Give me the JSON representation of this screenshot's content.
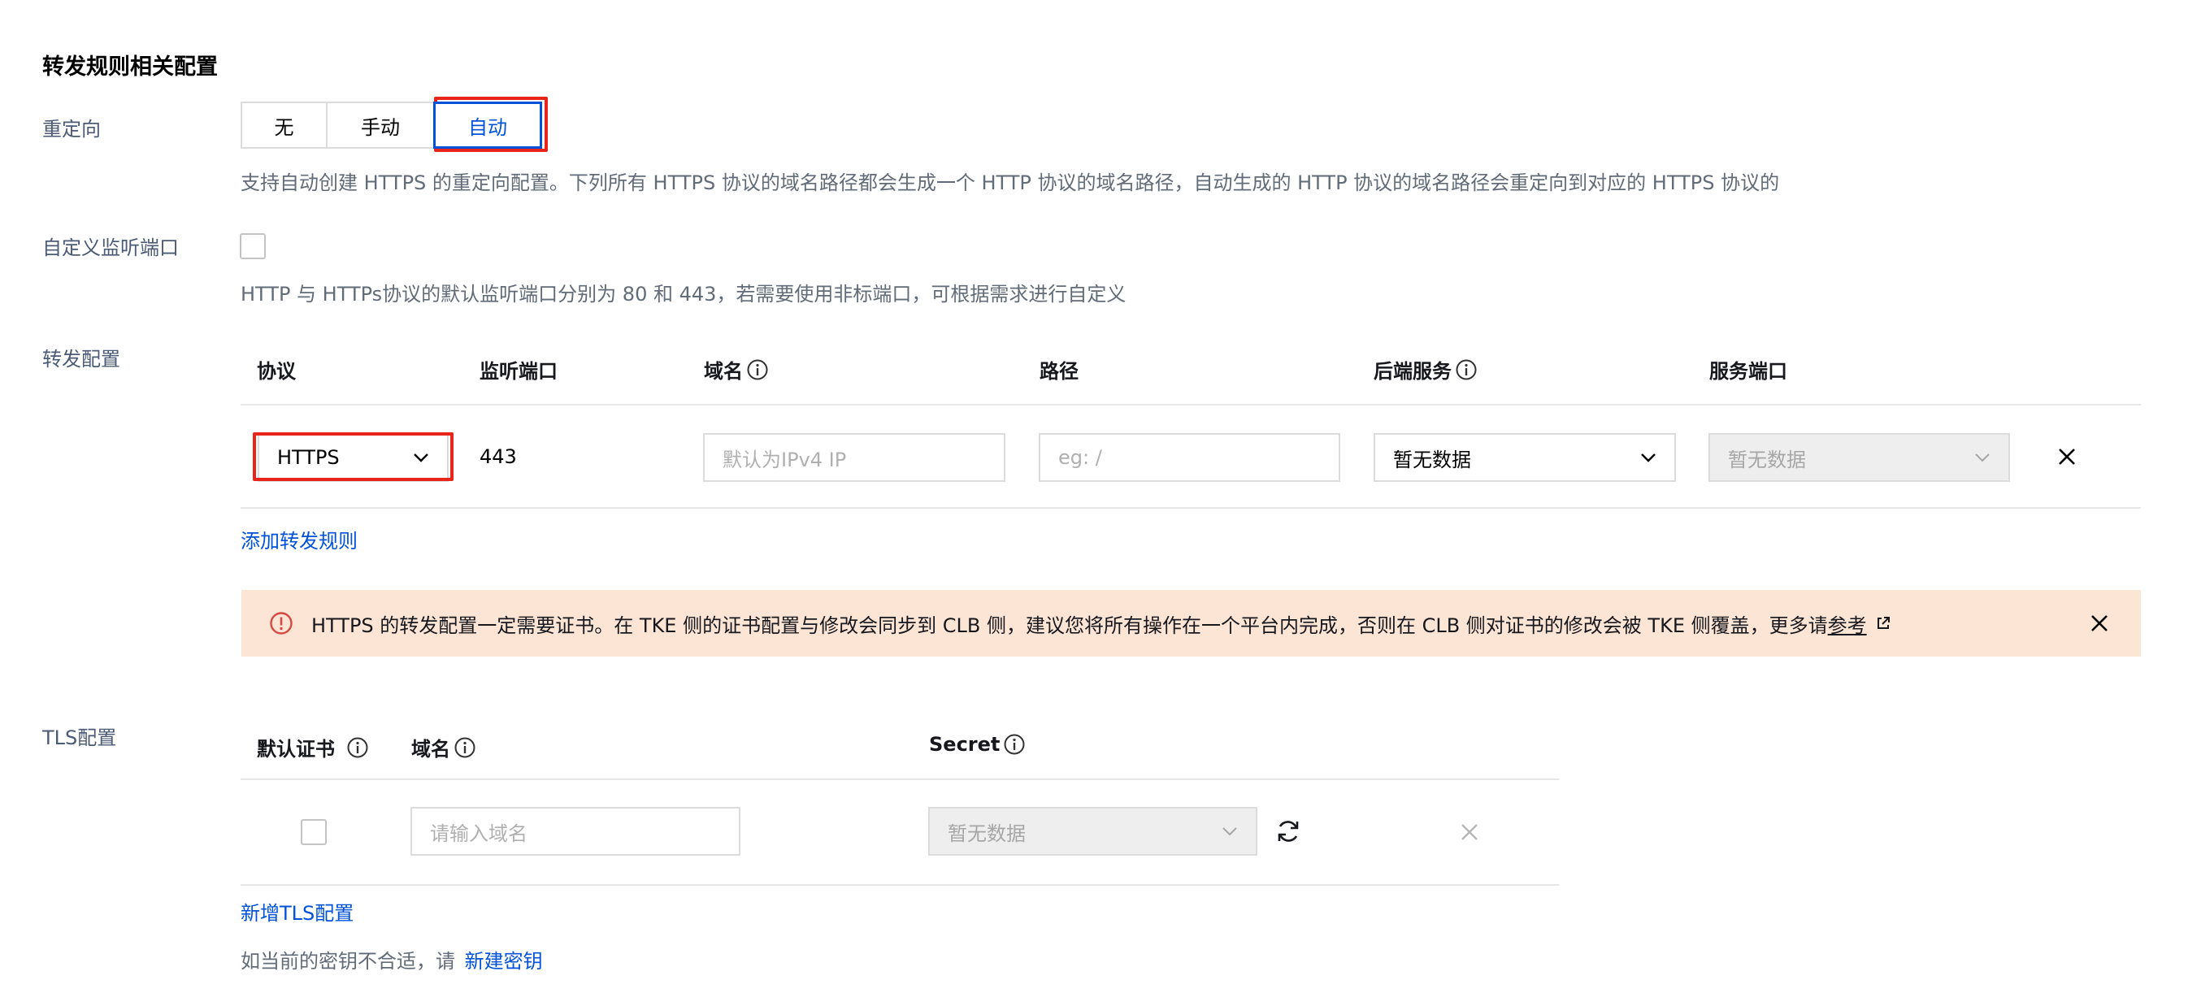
{
  "section_title": "转发规则相关配置",
  "redirect": {
    "label": "重定向",
    "options": [
      "无",
      "手动",
      "自动"
    ],
    "selected": "自动",
    "help": "支持自动创建 HTTPS 的重定向配置。下列所有 HTTPS 协议的域名路径都会生成一个 HTTP 协议的域名路径，自动生成的 HTTP 协议的域名路径会重定向到对应的 HTTPS 协议的"
  },
  "custom_port": {
    "label": "自定义监听端口",
    "checked": false,
    "help": "HTTP 与 HTTPs协议的默认监听端口分别为 80 和 443，若需要使用非标端口，可根据需求进行自定义"
  },
  "forward": {
    "label": "转发配置",
    "headers": {
      "protocol": "协议",
      "port": "监听端口",
      "domain": "域名",
      "path": "路径",
      "backend": "后端服务",
      "service_port": "服务端口"
    },
    "row": {
      "protocol": "HTTPS",
      "port": "443",
      "domain_placeholder": "默认为IPv4 IP",
      "path_placeholder": "eg: /",
      "backend": "暂无数据",
      "service_port": "暂无数据"
    },
    "add_link": "添加转发规则"
  },
  "warning": {
    "text": "HTTPS 的转发配置一定需要证书。在 TKE 侧的证书配置与修改会同步到 CLB 侧，建议您将所有操作在一个平台内完成，否则在 CLB 侧对证书的修改会被 TKE 侧覆盖，更多请",
    "link": "参考",
    "icon": "warning-circle-icon",
    "bg_color": "#fde5d6",
    "icon_color": "#d54941"
  },
  "tls": {
    "label": "TLS配置",
    "headers": {
      "default_cert": "默认证书",
      "domain": "域名",
      "secret": "Secret"
    },
    "row": {
      "domain_placeholder": "请输入域名",
      "secret": "暂无数据"
    },
    "add_link": "新增TLS配置",
    "footer_text": "如当前的密钥不合适，请",
    "footer_link": "新建密钥"
  },
  "colors": {
    "accent": "#0052d9",
    "highlight": "#e9241a"
  }
}
